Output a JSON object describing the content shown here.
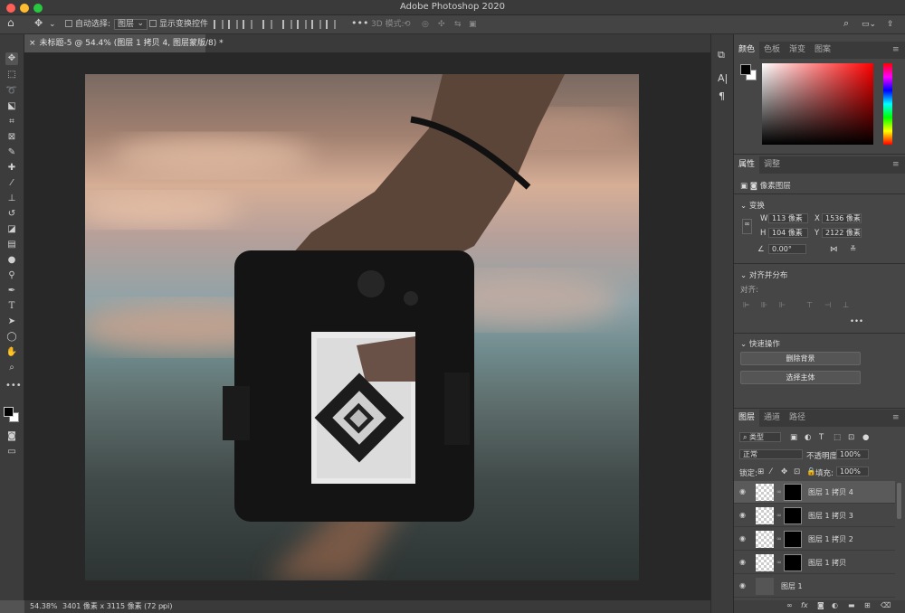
{
  "window": {
    "title": "Adobe Photoshop 2020"
  },
  "options_bar": {
    "auto_select_label": "自动选择:",
    "auto_select_value": "图层",
    "show_transform_label": "显示变换控件",
    "mode_3d_label": "3D 模式:"
  },
  "document": {
    "tab_title": "未标题-5 @ 54.4% (图层 1 拷贝 4, 图层蒙版/8) *"
  },
  "status": {
    "zoom": "54.38%",
    "info": "3401 像素 x 3115 像素 (72 ppi)"
  },
  "color_panel": {
    "tabs": [
      "颜色",
      "色板",
      "渐变",
      "图案"
    ],
    "active": 0
  },
  "properties_panel": {
    "tabs": [
      "属性",
      "调整"
    ],
    "active": 0,
    "layer_type": "像素图层",
    "transform_label": "变换",
    "w_label": "W",
    "w": "113 像素",
    "x_label": "X",
    "x": "1536 像素",
    "h_label": "H",
    "h": "104 像素",
    "y_label": "Y",
    "y": "2122 像素",
    "angle": "0.00°",
    "align_section": "对齐并分布",
    "align_label": "对齐:",
    "quick_actions": "快速操作",
    "remove_bg": "删除背景",
    "select_subject": "选择主体"
  },
  "layers_panel": {
    "tabs": [
      "图层",
      "通道",
      "路径"
    ],
    "active": 0,
    "filter_kind": "类型",
    "blend_mode": "正常",
    "opacity_label": "不透明度:",
    "opacity": "100%",
    "lock_label": "锁定:",
    "fill_label": "填充:",
    "fill": "100%",
    "layers": [
      {
        "name": "图层 1 拷贝 4"
      },
      {
        "name": "图层 1 拷贝 3"
      },
      {
        "name": "图层 1 拷贝 2"
      },
      {
        "name": "图层 1 拷贝"
      },
      {
        "name": "图层 1"
      }
    ]
  },
  "colors": {
    "accent": "#31a8ff",
    "foreground": "#000000",
    "background": "#ffffff"
  }
}
